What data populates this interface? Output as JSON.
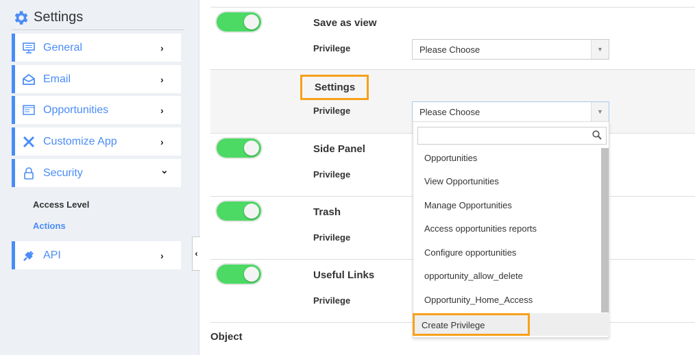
{
  "sidebar": {
    "title": "Settings",
    "items": [
      {
        "label": "General",
        "icon": "monitor-icon",
        "chevron": "›"
      },
      {
        "label": "Email",
        "icon": "email-icon",
        "chevron": "›"
      },
      {
        "label": "Opportunities",
        "icon": "window-icon",
        "chevron": "›"
      },
      {
        "label": "Customize App",
        "icon": "tools-icon",
        "chevron": "›"
      },
      {
        "label": "Security",
        "icon": "lock-icon",
        "chevron": "⌄"
      },
      {
        "label": "API",
        "icon": "plug-icon",
        "chevron": "›"
      }
    ],
    "sub_items": [
      {
        "label": "Access Level"
      },
      {
        "label": "Actions"
      }
    ]
  },
  "collapse": "‹",
  "colors": {
    "accent": "#4a8cf7",
    "toggle_on": "#4cd964",
    "highlight": "#f7a11a"
  },
  "rows": [
    {
      "title": "Save as view",
      "toggle": true,
      "privilege_label": "Privilege",
      "value": "Please Choose"
    },
    {
      "title": "Settings",
      "toggle": false,
      "privilege_label": "Privilege",
      "value": "Please Choose"
    },
    {
      "title": "Side Panel",
      "toggle": true,
      "privilege_label": "Privilege"
    },
    {
      "title": "Trash",
      "toggle": true,
      "privilege_label": "Privilege"
    },
    {
      "title": "Useful Links",
      "toggle": true,
      "privilege_label": "Privilege"
    }
  ],
  "object_label": "Object",
  "dropdown": {
    "search_value": "",
    "options": [
      "Opportunities",
      "View Opportunities",
      "Manage Opportunities",
      "Access opportunities reports",
      "Configure opportunities",
      "opportunity_allow_delete",
      "Opportunity_Home_Access"
    ],
    "create": "Create Privilege"
  }
}
